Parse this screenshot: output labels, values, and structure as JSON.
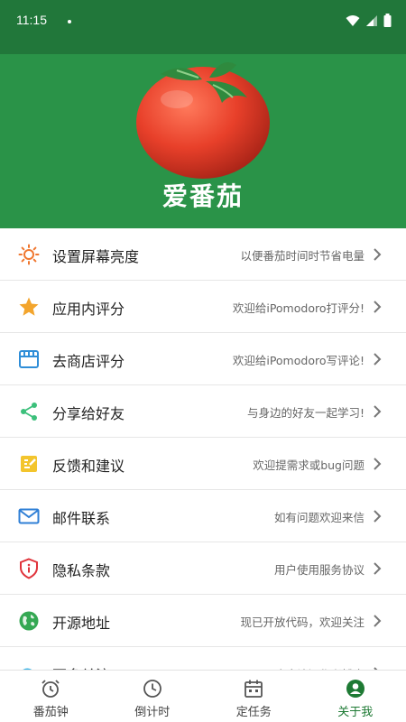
{
  "status_bar": {
    "time": "11:15",
    "icons": [
      "wifi-icon",
      "signal-icon",
      "battery-icon"
    ]
  },
  "header": {
    "app_title": "爱番茄",
    "colors": {
      "background": "#2a9348",
      "status_bar": "#21773a"
    }
  },
  "menu": [
    {
      "icon": "brightness-icon",
      "label": "设置屏幕亮度",
      "desc": "以便番茄时间时节省电量"
    },
    {
      "icon": "star-icon",
      "label": "应用内评分",
      "desc": "欢迎给iPomodoro打评分!"
    },
    {
      "icon": "store-icon",
      "label": "去商店评分",
      "desc": "欢迎给iPomodoro写评论!"
    },
    {
      "icon": "share-icon",
      "label": "分享给好友",
      "desc": "与身边的好友一起学习!"
    },
    {
      "icon": "feedback-icon",
      "label": "反馈和建议",
      "desc": "欢迎提需求或bug问题"
    },
    {
      "icon": "mail-icon",
      "label": "邮件联系",
      "desc": "如有问题欢迎来信"
    },
    {
      "icon": "privacy-shield-icon",
      "label": "隐私条款",
      "desc": "用户使用服务协议"
    },
    {
      "icon": "globe-icon",
      "label": "开源地址",
      "desc": "现已开放代码，欢迎关注"
    },
    {
      "icon": "follow-icon",
      "label": "更多关注",
      "desc": "欢迎访问作者博客"
    }
  ],
  "tabs": [
    {
      "icon": "alarm-clock-icon",
      "label": "番茄钟",
      "active": false
    },
    {
      "icon": "clock-icon",
      "label": "倒计时",
      "active": false
    },
    {
      "icon": "calendar-icon",
      "label": "定任务",
      "active": false
    },
    {
      "icon": "user-icon",
      "label": "关于我",
      "active": true
    }
  ]
}
